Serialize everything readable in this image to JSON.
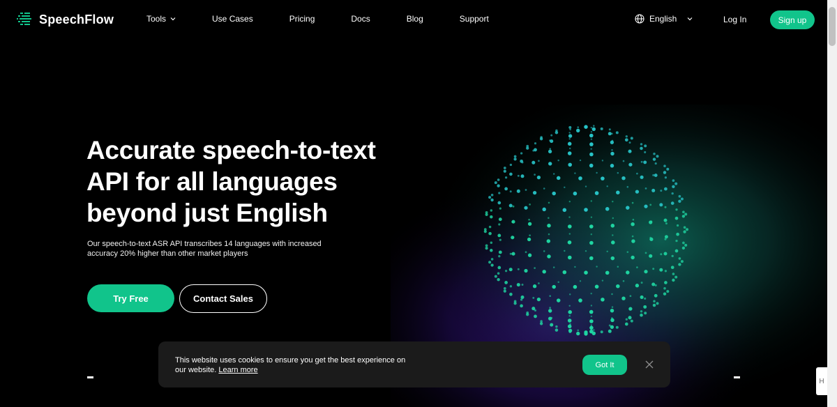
{
  "brand": {
    "name": "SpeechFlow",
    "accent": "#11c48b"
  },
  "nav": {
    "links": [
      {
        "label": "Tools",
        "has_dropdown": true
      },
      {
        "label": "Use Cases"
      },
      {
        "label": "Pricing"
      },
      {
        "label": "Docs"
      },
      {
        "label": "Blog"
      },
      {
        "label": "Support"
      }
    ],
    "language": "English",
    "login": "Log In",
    "signup": "Sign up"
  },
  "hero": {
    "title_lines": [
      "Accurate speech-to-text",
      "API for all languages",
      "beyond just English"
    ],
    "subtitle": "Our speech-to-text ASR API transcribes 14 languages with increased accuracy 20% higher than other market players",
    "cta_primary": "Try Free",
    "cta_secondary": "Contact Sales"
  },
  "cookie_banner": {
    "text": "This website uses cookies to ensure you get the best experience on our website.",
    "link": "Learn more",
    "accept": "Got It",
    "close_icon": "close-icon"
  },
  "side_widget": {
    "label": "H"
  }
}
